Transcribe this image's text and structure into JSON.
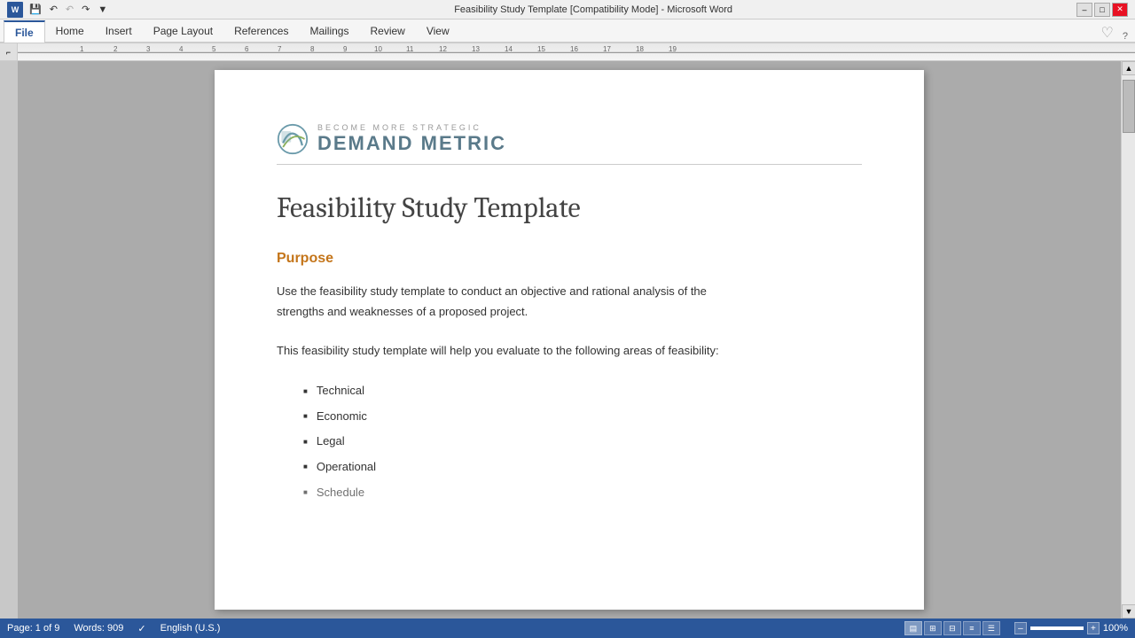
{
  "titleBar": {
    "title": "Feasibility Study Template [Compatibility Mode] - Microsoft Word",
    "minimize": "–",
    "maximize": "□",
    "close": "✕"
  },
  "quickAccess": {
    "save": "💾",
    "undo": "↶",
    "redo": "↷",
    "dropdown": "▼"
  },
  "ribbonTabs": [
    {
      "label": "File",
      "active": true
    },
    {
      "label": "Home",
      "active": false
    },
    {
      "label": "Insert",
      "active": false
    },
    {
      "label": "Page Layout",
      "active": false
    },
    {
      "label": "References",
      "active": false
    },
    {
      "label": "Mailings",
      "active": false
    },
    {
      "label": "Review",
      "active": false
    },
    {
      "label": "View",
      "active": false
    }
  ],
  "logo": {
    "tagline": "Become More Strategic",
    "name": "Demand Metric"
  },
  "document": {
    "title": "Feasibility Study Template",
    "sections": [
      {
        "heading": "Purpose",
        "paragraphs": [
          "Use the feasibility study template to conduct an objective and rational analysis of the strengths and weaknesses of a proposed project.",
          "This feasibility study template will help you evaluate to the following areas of feasibility:"
        ],
        "bullets": [
          "Technical",
          "Economic",
          "Legal",
          "Operational",
          "Schedule"
        ]
      }
    ]
  },
  "statusBar": {
    "page": "Page: 1 of 9",
    "words": "Words: 909",
    "language": "English (U.S.)",
    "zoom": "100%"
  }
}
